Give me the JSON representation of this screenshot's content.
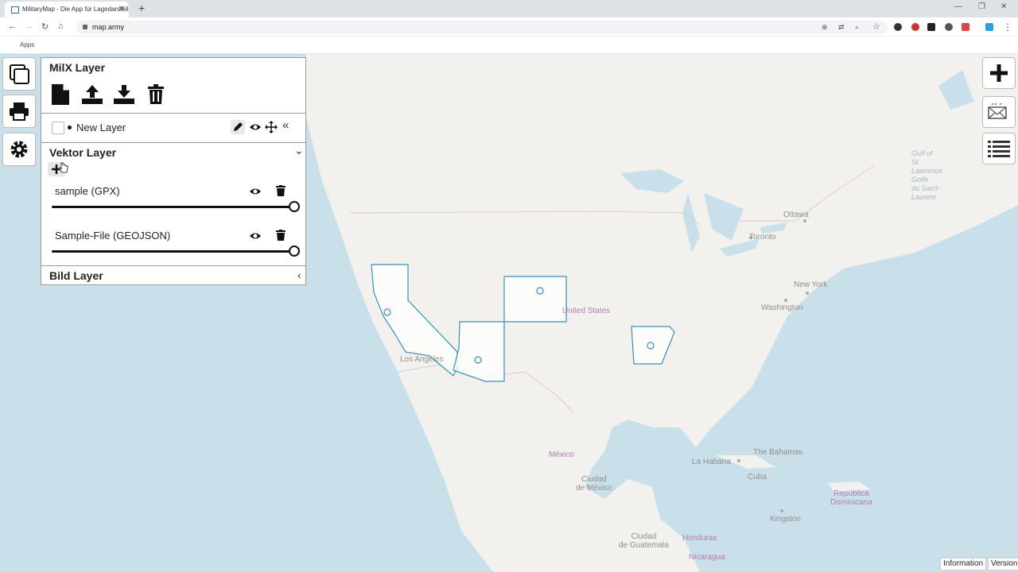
{
  "browser": {
    "tab_title": "MilitaryMap - Die App für Lagedarstellung",
    "url": "map.army",
    "bookmarks_apps": "Apps",
    "new_tab_symbol": "+",
    "close_symbol": "✕"
  },
  "panel": {
    "milx_title": "MilX Layer",
    "new_layer_label": "New Layer",
    "vektor_title": "Vektor Layer",
    "vektor_layers": [
      {
        "name": "sample (GPX)",
        "opacity": 1.0
      },
      {
        "name": "Sample-File (GEOJSON)",
        "opacity": 1.0
      }
    ],
    "bild_title": "Bild Layer",
    "collapse_symbol": "«",
    "chevron_down": "⌄",
    "chevron_left": "‹"
  },
  "map": {
    "labels": {
      "ottawa": "Ottawa",
      "toronto": "Toronto",
      "new_york": "New York",
      "washington": "Washington",
      "united_states": "United States",
      "los_angeles": "Los Angeles",
      "mexico": "México",
      "ciudad_mexico": "Ciudad\nde México",
      "la_habana": "La Habana",
      "cuba": "Cuba",
      "bahamas": "The Bahamas",
      "kingston": "Kingston",
      "republica": "República\nDominicana",
      "honduras": "Honduras",
      "ciudad_guatemala": "Ciudad\nde Guatemala",
      "nicaragua": "Nicaragua",
      "gulf": "Gulf of\nSt.\nLawrence\nGolfe\ndu Saint-\nLaurent"
    }
  },
  "footer": {
    "information": "Information",
    "version": "Version"
  },
  "colors": {
    "water": "#c9e0ea",
    "land": "#f2f1ee",
    "feature_stroke": "#3a8fc0"
  }
}
